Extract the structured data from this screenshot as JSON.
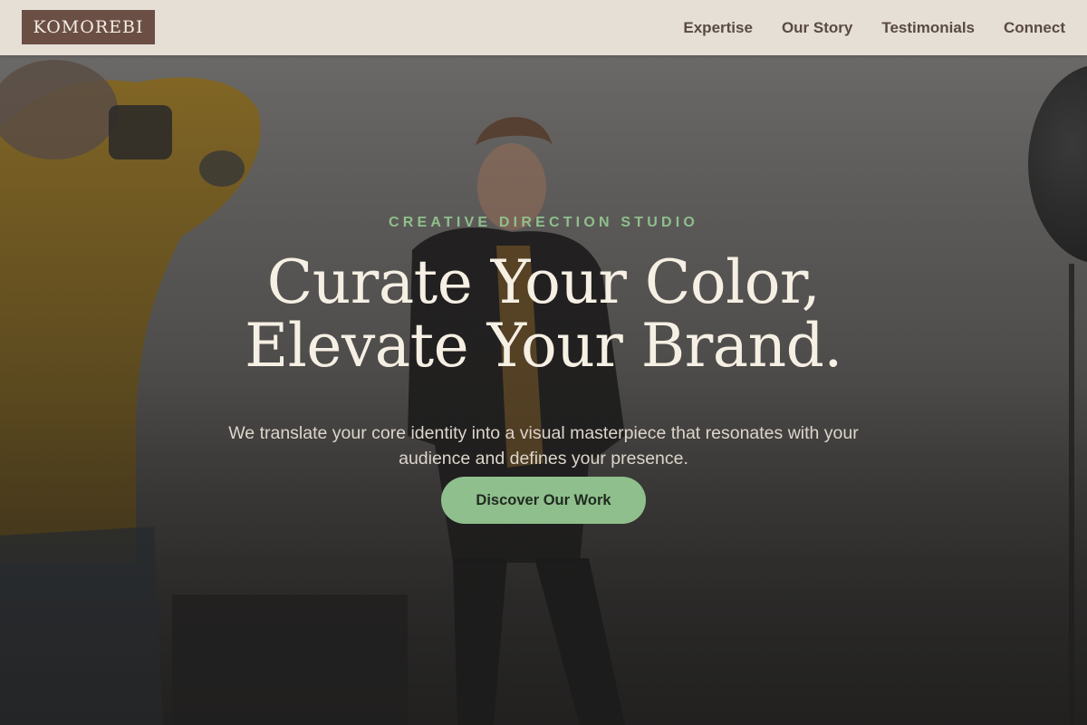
{
  "brand": {
    "logo_text": "KOMOREBI"
  },
  "nav": {
    "items": [
      {
        "label": "Expertise"
      },
      {
        "label": "Our Story"
      },
      {
        "label": "Testimonials"
      },
      {
        "label": "Connect"
      }
    ]
  },
  "hero": {
    "eyebrow": "CREATIVE DIRECTION STUDIO",
    "headline_line1": "Curate Your Color,",
    "headline_line2": "Elevate Your Brand.",
    "subtext": "We translate your core identity into a visual masterpiece that resonates with your audience and defines your presence.",
    "cta_label": "Discover Our Work"
  },
  "colors": {
    "header_bg": "#e5dfd6",
    "logo_bg": "#6b4f45",
    "nav_text": "#5a4a42",
    "accent_green": "#8fbf8c",
    "headline_text": "#f6efe4"
  }
}
